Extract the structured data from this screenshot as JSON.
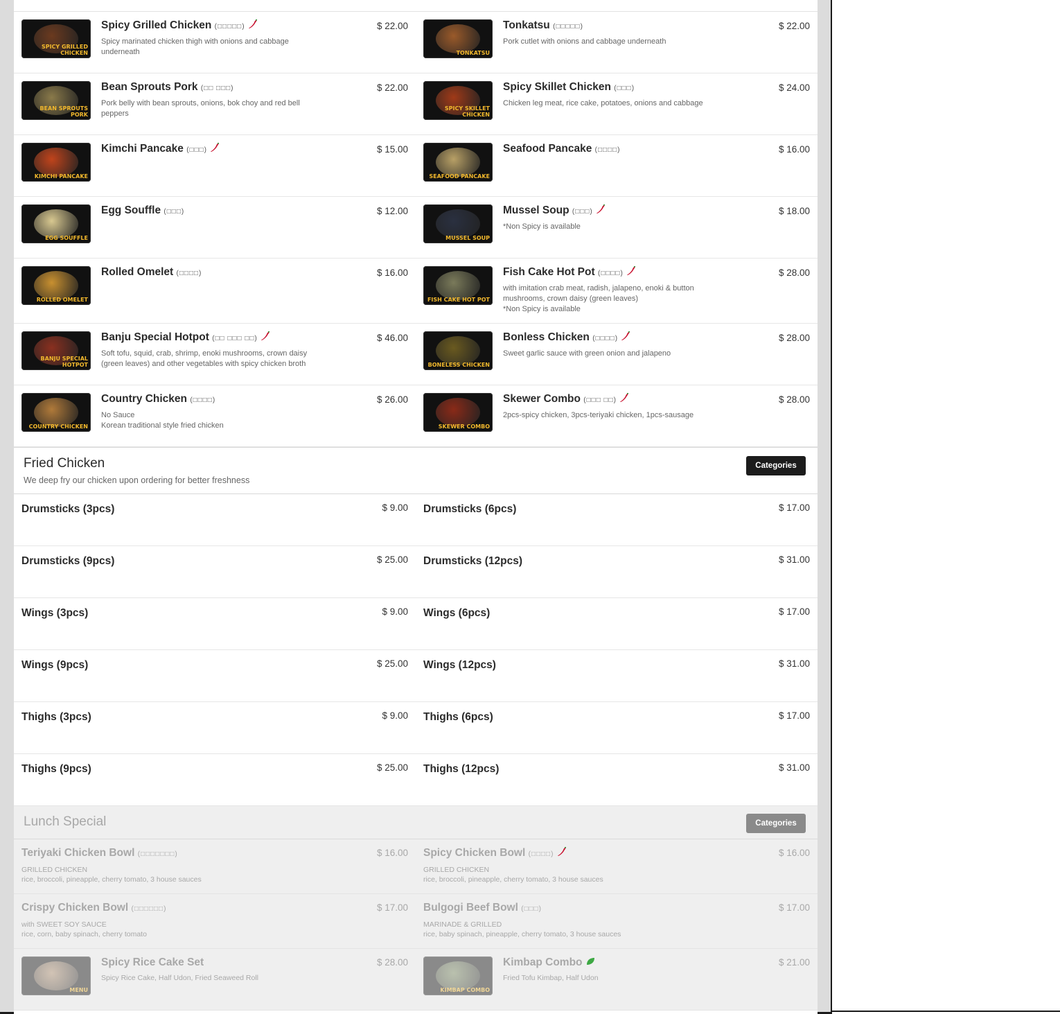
{
  "colors": {
    "accent": "#1c1c1c",
    "chili": "#c8102e",
    "leaf": "#3da843",
    "caption": "#f2b82d"
  },
  "appetizers": [
    {
      "name": "Spicy Grilled Chicken",
      "korean": "(□□□□□)",
      "spicy": true,
      "desc": "Spicy marinated chicken thigh with onions and cabbage underneath",
      "price": "$ 22.00",
      "caption": "SPICY GRILLED CHICKEN",
      "tone": "#6b3a1f"
    },
    {
      "name": "Tonkatsu",
      "korean": "(□□□□□)",
      "spicy": false,
      "desc": "Pork cutlet with onions and cabbage underneath",
      "price": "$ 22.00",
      "caption": "TONKATSU",
      "tone": "#9a5a2a"
    },
    {
      "name": "Bean Sprouts Pork",
      "korean": "(□□ □□□)",
      "spicy": false,
      "desc": "Pork belly with bean sprouts, onions, bok choy and red bell peppers",
      "price": "$ 22.00",
      "caption": "BEAN SPROUTS PORK",
      "tone": "#8a7a4a"
    },
    {
      "name": "Spicy Skillet Chicken",
      "korean": "(□□□)",
      "spicy": false,
      "desc": "Chicken leg meat, rice cake, potatoes, onions and cabbage",
      "price": "$ 24.00",
      "caption": "SPICY SKILLET CHICKEN",
      "tone": "#a03a18"
    },
    {
      "name": "Kimchi Pancake",
      "korean": "(□□□)",
      "spicy": true,
      "desc": "",
      "price": "$ 15.00",
      "caption": "KIMCHI PANCAKE",
      "tone": "#c0441c"
    },
    {
      "name": "Seafood Pancake",
      "korean": "(□□□□)",
      "spicy": false,
      "desc": "",
      "price": "$ 16.00",
      "caption": "SEAFOOD PANCAKE",
      "tone": "#b8a066"
    },
    {
      "name": "Egg Souffle",
      "korean": "(□□□)",
      "spicy": false,
      "desc": "",
      "price": "$ 12.00",
      "caption": "EGG SOUFFLE",
      "tone": "#d8c890"
    },
    {
      "name": "Mussel Soup",
      "korean": "(□□□)",
      "spicy": true,
      "desc": "*Non Spicy is available",
      "price": "$ 18.00",
      "caption": "MUSSEL SOUP",
      "tone": "#2a3040"
    },
    {
      "name": "Rolled Omelet",
      "korean": "(□□□□)",
      "spicy": false,
      "desc": "",
      "price": "$ 16.00",
      "caption": "ROLLED OMELET",
      "tone": "#c89030"
    },
    {
      "name": "Fish Cake Hot Pot",
      "korean": "(□□□□)",
      "spicy": true,
      "desc": "with imitation crab meat, radish, jalapeno, enoki & button mushrooms, crown daisy (green leaves)\n*Non Spicy is available",
      "price": "$ 28.00",
      "caption": "FISH CAKE HOT POT",
      "tone": "#7a7a5a"
    },
    {
      "name": "Banju Special Hotpot",
      "korean": "(□□ □□□ □□)",
      "spicy": true,
      "desc": "Soft tofu, squid, crab, shrimp, enoki mushrooms, crown daisy (green leaves) and other vegetables with spicy chicken broth",
      "price": "$ 46.00",
      "caption": "BANJU SPECIAL HOTPOT",
      "tone": "#8a3020"
    },
    {
      "name": "Bonless Chicken",
      "korean": "(□□□□)",
      "spicy": true,
      "desc": "Sweet garlic sauce with green onion and jalapeno",
      "price": "$ 28.00",
      "caption": "BONELESS CHICKEN",
      "tone": "#6a5a20"
    },
    {
      "name": "Country Chicken",
      "korean": "(□□□□)",
      "spicy": false,
      "desc": "No Sauce\nKorean traditional style fried chicken",
      "price": "$ 26.00",
      "caption": "COUNTRY CHICKEN",
      "tone": "#b07a3a"
    },
    {
      "name": "Skewer Combo",
      "korean": "(□□□ □□)",
      "spicy": true,
      "desc": "2pcs-spicy chicken, 3pcs-teriyaki chicken, 1pcs-sausage",
      "price": "$ 28.00",
      "caption": "SKEWER COMBO",
      "tone": "#8a2a18"
    }
  ],
  "fried_chicken": {
    "title": "Fried Chicken",
    "subtitle": "We deep fry our chicken upon ordering for better freshness",
    "categories_label": "Categories",
    "items": [
      {
        "name": "Drumsticks (3pcs)",
        "price": "$ 9.00"
      },
      {
        "name": "Drumsticks (6pcs)",
        "price": "$ 17.00"
      },
      {
        "name": "Drumsticks (9pcs)",
        "price": "$ 25.00"
      },
      {
        "name": "Drumsticks (12pcs)",
        "price": "$ 31.00"
      },
      {
        "name": "Wings (3pcs)",
        "price": "$ 9.00"
      },
      {
        "name": "Wings (6pcs)",
        "price": "$ 17.00"
      },
      {
        "name": "Wings (9pcs)",
        "price": "$ 25.00"
      },
      {
        "name": "Wings (12pcs)",
        "price": "$ 31.00"
      },
      {
        "name": "Thighs (3pcs)",
        "price": "$ 9.00"
      },
      {
        "name": "Thighs (6pcs)",
        "price": "$ 17.00"
      },
      {
        "name": "Thighs (9pcs)",
        "price": "$ 25.00"
      },
      {
        "name": "Thighs (12pcs)",
        "price": "$ 31.00"
      }
    ]
  },
  "lunch_special": {
    "title": "Lunch Special",
    "categories_label": "Categories",
    "items": [
      {
        "name": "Teriyaki Chicken Bowl",
        "korean": "(□□□□□□□)",
        "icon": "",
        "desc": "GRILLED CHICKEN\nrice, broccoli, pineapple, cherry tomato, 3 house sauces",
        "price": "$ 16.00",
        "photo": false
      },
      {
        "name": "Spicy Chicken Bowl",
        "korean": "(□□□□)",
        "icon": "chili",
        "desc": "GRILLED CHICKEN\nrice, broccoli, pineapple, cherry tomato, 3 house sauces",
        "price": "$ 16.00",
        "photo": false
      },
      {
        "name": "Crispy Chicken Bowl",
        "korean": "(□□□□□□)",
        "icon": "",
        "desc": "with SWEET SOY SAUCE\nrice, corn, baby spinach, cherry tomato",
        "price": "$ 17.00",
        "photo": false
      },
      {
        "name": "Bulgogi Beef Bowl",
        "korean": "(□□□)",
        "icon": "",
        "desc": "MARINADE & GRILLED\nrice, baby spinach, pineapple, cherry tomato, 3 house sauces",
        "price": "$ 17.00",
        "photo": false
      },
      {
        "name": "Spicy Rice Cake Set",
        "korean": "",
        "icon": "",
        "desc": "Spicy Rice Cake, Half Udon, Fried Seaweed Roll",
        "price": "$ 28.00",
        "photo": true,
        "caption": "MENU",
        "tone": "#b09070"
      },
      {
        "name": "Kimbap Combo",
        "korean": "",
        "icon": "leaf",
        "desc": "Fried Tofu Kimbap, Half Udon",
        "price": "$ 21.00",
        "photo": true,
        "caption": "KIMBAP COMBO",
        "tone": "#7a8a60"
      }
    ]
  }
}
